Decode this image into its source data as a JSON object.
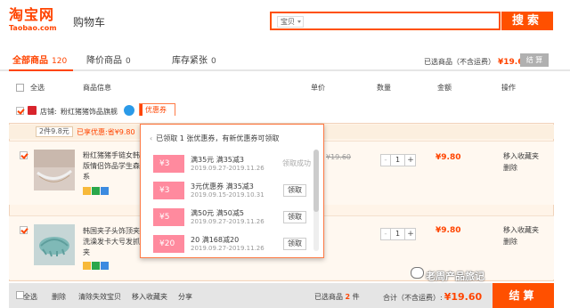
{
  "header": {
    "logo_cn": "淘宝网",
    "logo_en": "Taobao.com",
    "page_title": "购物车",
    "search_type": "宝贝",
    "search_button": "搜索"
  },
  "tabs": [
    {
      "label": "全部商品",
      "count": "120"
    },
    {
      "label": "降价商品",
      "count": "0"
    },
    {
      "label": "库存紧张",
      "count": "0"
    }
  ],
  "summary": {
    "label": "已选商品（不含运费）",
    "price": "¥19.60",
    "settle": "结 算"
  },
  "columns": {
    "select_all": "全选",
    "product": "商品信息",
    "unit_price": "单价",
    "quantity": "数量",
    "amount": "金额",
    "actions": "操作"
  },
  "shop": {
    "label": "店铺:",
    "name": "粉红猪猪饰品旗舰",
    "coupon_button": "优惠券"
  },
  "promo": {
    "tag": "2件9.8元",
    "text": "已享优惠:省¥9.80"
  },
  "items": [
    {
      "title": "粉红猪猪手链女韩版情侣饰品学生森系",
      "original_price": "¥19.60",
      "quantity": "1",
      "subtotal": "¥9.80",
      "actions": [
        "移入收藏夹",
        "删除"
      ]
    },
    {
      "title": "韩国夹子头饰顶夹洗澡发卡大号发抓夹",
      "quantity": "1",
      "subtotal": "¥9.80",
      "actions": [
        "移入收藏夹",
        "删除"
      ]
    }
  ],
  "ui": {
    "minus": "-",
    "plus": "+",
    "arrow": "‹"
  },
  "coupons": {
    "header": "已领取 1 张优惠券，有新优惠券可领取",
    "list": [
      {
        "value": "¥3",
        "title": "满35元 满35减3",
        "dates": "2019.09.27-2019.11.26",
        "action": "领取成功"
      },
      {
        "value": "¥3",
        "title": "3元优惠券 满35减3",
        "dates": "2019.09.15-2019.10.31",
        "action": "领取"
      },
      {
        "value": "¥5",
        "title": "满50元 满50减5",
        "dates": "2019.09.27-2019.11.26",
        "action": "领取"
      },
      {
        "value": "¥20",
        "title": "20 满168减20",
        "dates": "2019.09.27-2019.11.26",
        "action": "领取"
      }
    ]
  },
  "footer": {
    "select_all": "全选",
    "delete": "删除",
    "clear_invalid": "清除失效宝贝",
    "move_favorites": "移入收藏夹",
    "share": "分享",
    "selected_label": "已选商品",
    "selected_count": "2",
    "selected_unit": "件",
    "total_label": "合计（不含运费）:",
    "total": "¥19.60",
    "settle": "结算"
  },
  "watermark": "老周产品旅记"
}
